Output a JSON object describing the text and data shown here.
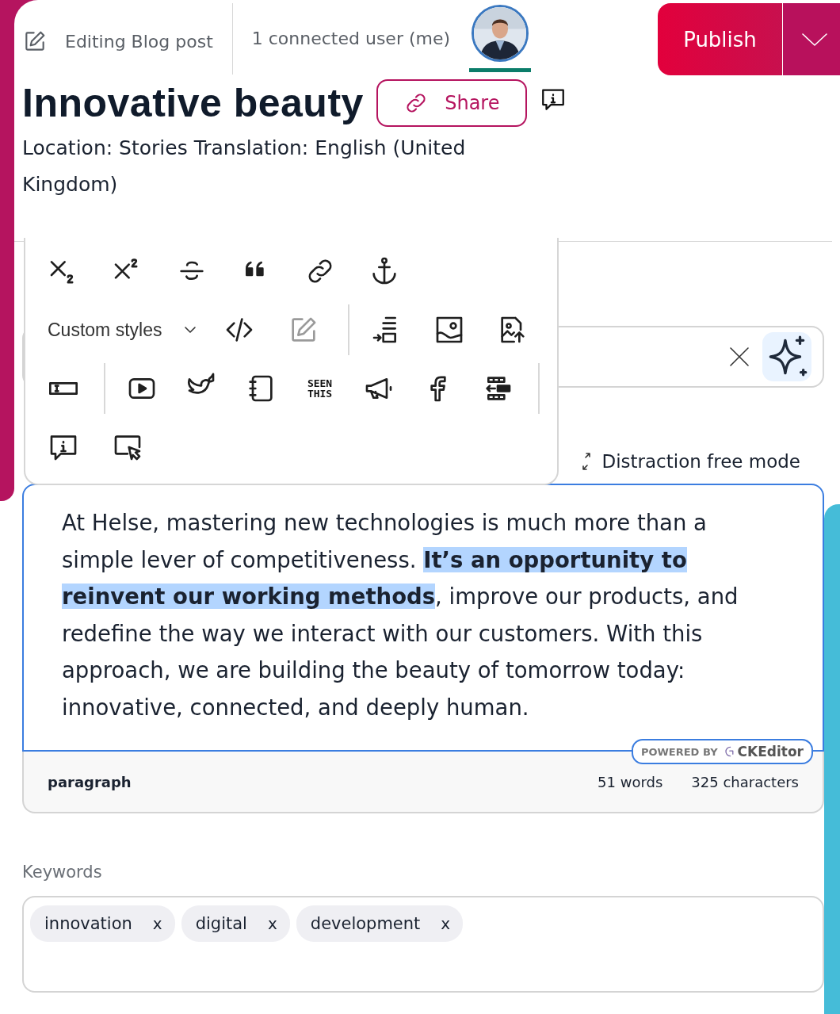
{
  "header": {
    "editing_label": "Editing Blog post",
    "connected_users": "1 connected user (me)",
    "publish": "Publish"
  },
  "title": "Innovative beauty",
  "share": "Share",
  "location": "Location: Stories Translation: English (United Kingdom)",
  "toolbar": {
    "style_dropdown": "Custom styles",
    "seenthis_label": "SEEN THIS",
    "source_edit": {
      "disabled": true
    }
  },
  "distraction_free": "Distraction free mode",
  "editor": {
    "content": "At Helse, mastering new technologies is much more than a simple lever of competitiveness. **It’s an opportunity to reinvent our working methods**, improve our products, and redefine the way we interact with our customers. With this approach, we are building the beauty of tomorrow today: innovative, connected, and deeply human.",
    "badge_prefix": "POWERED BY",
    "badge_brand": "CKEditor",
    "element_path": "paragraph",
    "word_count": "51 words",
    "char_count": "325 characters"
  },
  "keywords": {
    "label": "Keywords",
    "tags": [
      {
        "label": "innovation",
        "remove": "x"
      },
      {
        "label": "digital",
        "remove": "x"
      },
      {
        "label": "development",
        "remove": "x"
      }
    ]
  }
}
